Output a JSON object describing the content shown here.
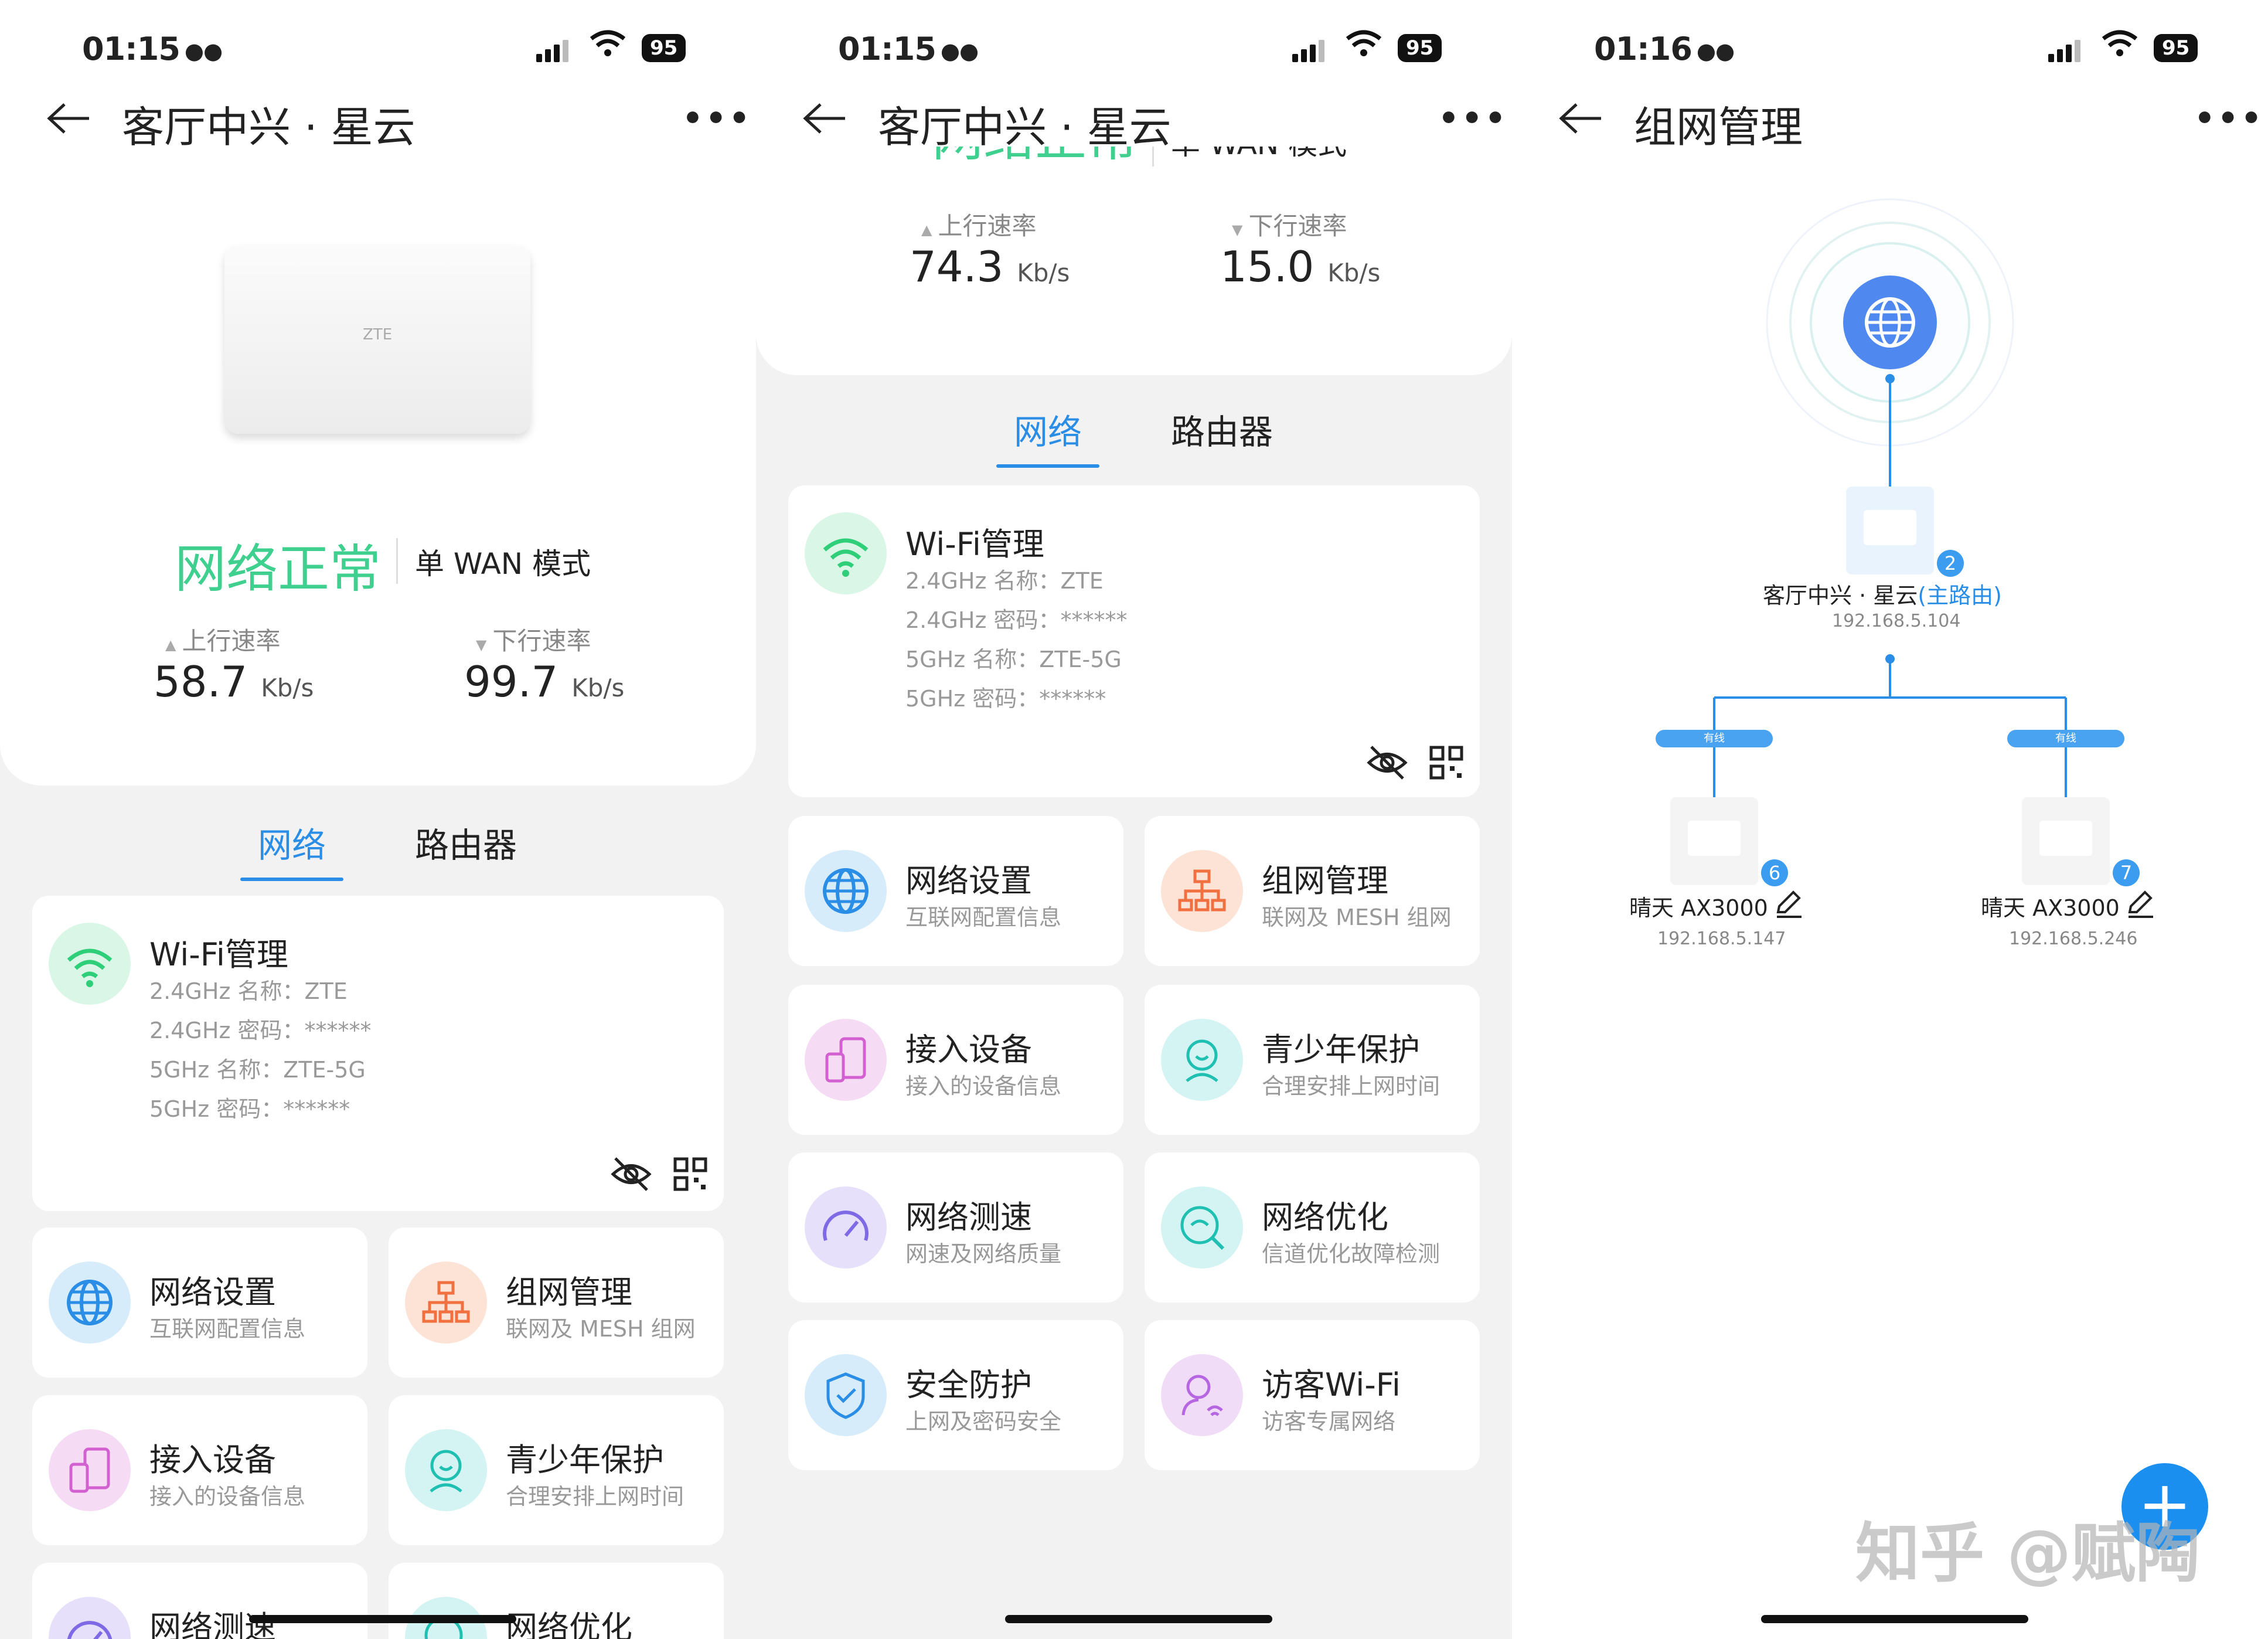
{
  "status_bars": [
    {
      "time": "01:15",
      "battery": "95"
    },
    {
      "time": "01:15",
      "battery": "95"
    },
    {
      "time": "01:16",
      "battery": "95"
    }
  ],
  "panel1": {
    "nav_title": "客厅中兴 · 星云",
    "router_brand": "ZTE",
    "network_status": "网络正常",
    "wan_mode": "单 WAN 模式",
    "upload_label": "上行速率",
    "upload_value": "58.7",
    "download_label": "下行速率",
    "download_value": "99.7",
    "unit": "Kb/s",
    "tabs": [
      "网络",
      "路由器"
    ],
    "wifi": {
      "title": "Wi-Fi管理",
      "lines": [
        "2.4GHz 名称：ZTE",
        "2.4GHz 密码：******",
        "5GHz 名称：ZTE-5G",
        "5GHz 密码：******"
      ]
    },
    "tiles": [
      {
        "title": "网络设置",
        "sub": "互联网配置信息"
      },
      {
        "title": "组网管理",
        "sub": "联网及 MESH 组网"
      },
      {
        "title": "接入设备",
        "sub": "接入的设备信息"
      },
      {
        "title": "青少年保护",
        "sub": "合理安排上网时间"
      },
      {
        "title": "网络测速",
        "sub": ""
      },
      {
        "title": "网络优化",
        "sub": ""
      }
    ]
  },
  "panel2": {
    "nav_title": "客厅中兴 · 星云",
    "network_status_partial": "网络正常",
    "wan_partial": "单 WAN 模式",
    "upload_label": "上行速率",
    "upload_value": "74.3",
    "download_label": "下行速率",
    "download_value": "15.0",
    "unit": "Kb/s",
    "tabs": [
      "网络",
      "路由器"
    ],
    "wifi": {
      "title": "Wi-Fi管理",
      "lines": [
        "2.4GHz 名称：ZTE",
        "2.4GHz 密码：******",
        "5GHz 名称：ZTE-5G",
        "5GHz 密码：******"
      ]
    },
    "tiles": [
      {
        "title": "网络设置",
        "sub": "互联网配置信息"
      },
      {
        "title": "组网管理",
        "sub": "联网及 MESH 组网"
      },
      {
        "title": "接入设备",
        "sub": "接入的设备信息"
      },
      {
        "title": "青少年保护",
        "sub": "合理安排上网时间"
      },
      {
        "title": "网络测速",
        "sub": "网速及网络质量"
      },
      {
        "title": "网络优化",
        "sub": "信道优化故障检测"
      },
      {
        "title": "安全防护",
        "sub": "上网及密码安全"
      },
      {
        "title": "访客Wi-Fi",
        "sub": "访客专属网络"
      }
    ]
  },
  "panel3": {
    "nav_title": "组网管理",
    "main_router": {
      "name": "客厅中兴 · 星云",
      "role": "(主路由)",
      "ip": "192.168.5.104",
      "badge": "2"
    },
    "link_label": "有线",
    "nodes": [
      {
        "name": "晴天 AX3000",
        "ip": "192.168.5.147",
        "badge": "6"
      },
      {
        "name": "晴天 AX3000",
        "ip": "192.168.5.246",
        "badge": "7"
      }
    ],
    "fab": "+",
    "watermark": "知乎 @赋陶"
  }
}
